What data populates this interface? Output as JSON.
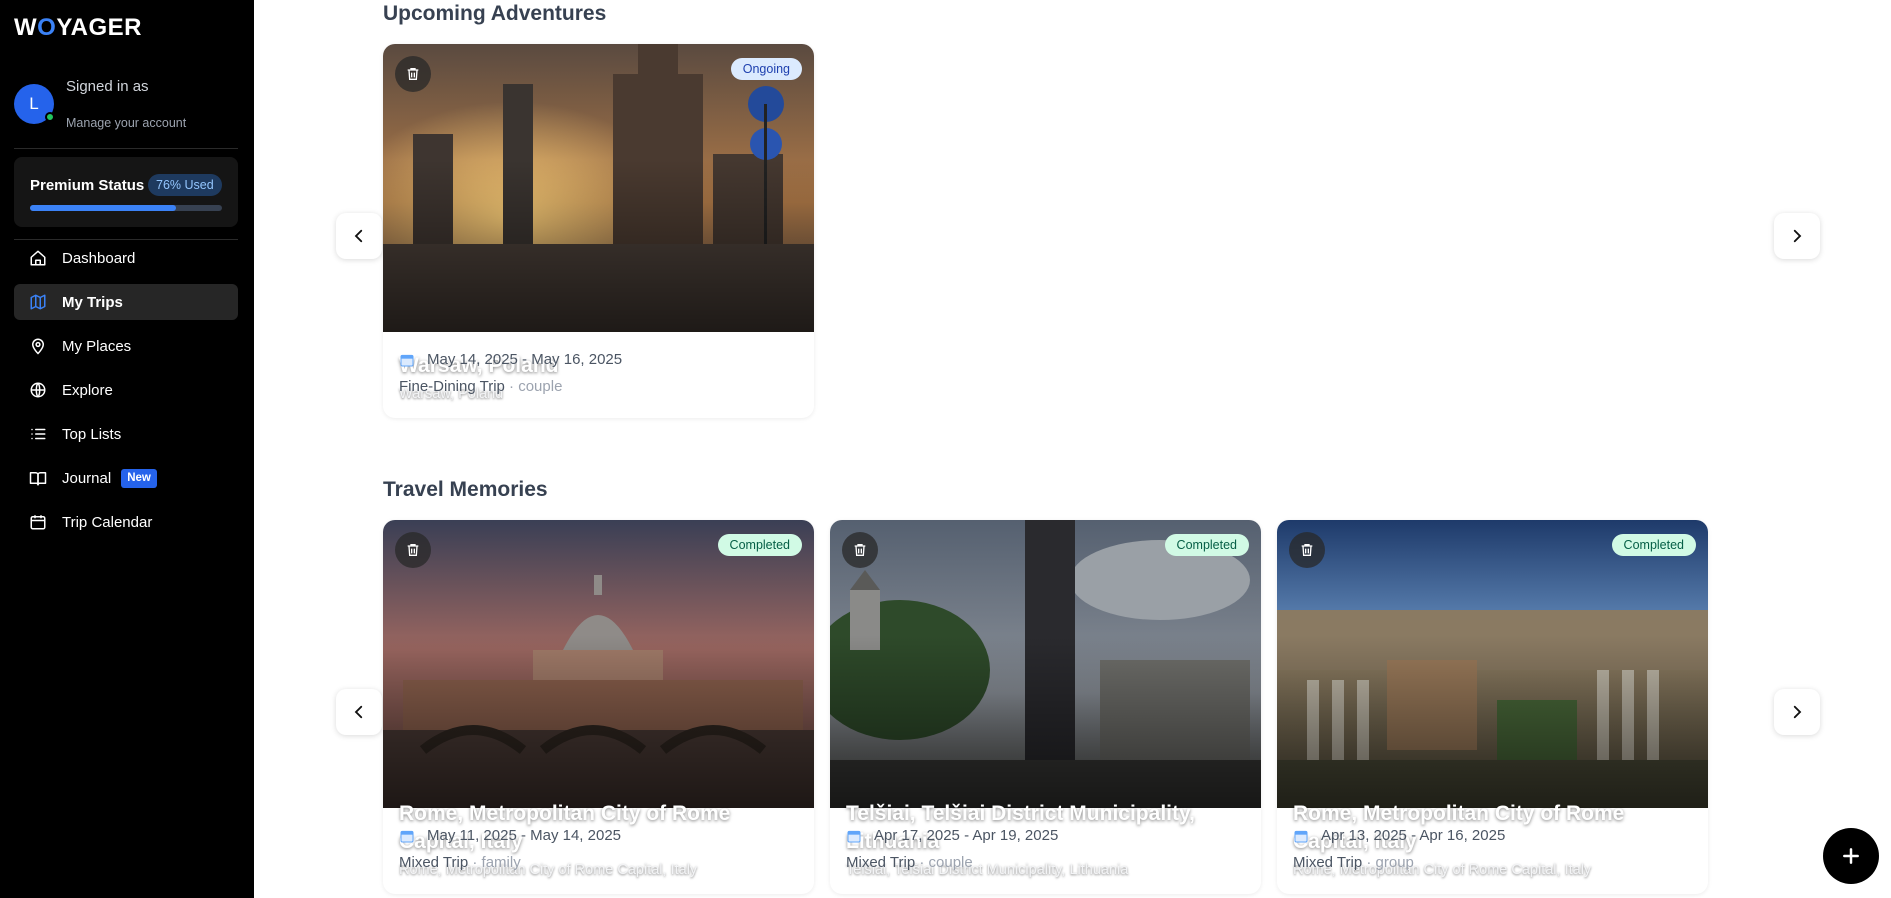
{
  "brand": {
    "logo_pre": "W",
    "logo_o": "O",
    "logo_post": "YAGER"
  },
  "user": {
    "initial": "L",
    "signed_in": "Signed in as",
    "manage": "Manage your account"
  },
  "premium": {
    "label": "Premium Status",
    "badge": "76% Used",
    "used_fraction": 0.76
  },
  "nav": [
    {
      "label": "Dashboard",
      "icon": "home-icon"
    },
    {
      "label": "My Trips",
      "icon": "map-icon",
      "active": true
    },
    {
      "label": "My Places",
      "icon": "map-pin-icon"
    },
    {
      "label": "Explore",
      "icon": "globe-icon"
    },
    {
      "label": "Top Lists",
      "icon": "list-icon"
    },
    {
      "label": "Journal",
      "icon": "book-icon",
      "badge": "New"
    },
    {
      "label": "Trip Calendar",
      "icon": "calendar-icon"
    }
  ],
  "sections": {
    "upcoming": {
      "title": "Upcoming Adventures",
      "cards": [
        {
          "status": "Ongoing",
          "title": "Warsaw, Poland",
          "subtitle": "Warsaw, Poland",
          "dates": "May 14, 2025 - May 16, 2025",
          "trip_type": "Fine-Dining Trip",
          "companions": "· couple"
        }
      ]
    },
    "memories": {
      "title": "Travel Memories",
      "cards": [
        {
          "status": "Completed",
          "title": "Rome, Metropolitan City of Rome Capital, Italy",
          "subtitle": "Rome, Metropolitan City of Rome Capital, Italy",
          "dates": "May 11, 2025 - May 14, 2025",
          "trip_type": "Mixed Trip",
          "companions": "· family"
        },
        {
          "status": "Completed",
          "title": "Telšiai, Telšiai District Municipality, Lithuania",
          "subtitle": "Telšiai, Telšiai District Municipality, Lithuania",
          "dates": "Apr 17, 2025 - Apr 19, 2025",
          "trip_type": "Mixed Trip",
          "companions": "· couple"
        },
        {
          "status": "Completed",
          "title": "Rome, Metropolitan City of Rome Capital, Italy",
          "subtitle": "Rome, Metropolitan City of Rome Capital, Italy",
          "dates": "Apr 13, 2025 - Apr 16, 2025",
          "trip_type": "Mixed Trip",
          "companions": "· group"
        }
      ]
    }
  },
  "colors": {
    "accent": "#3b82f6",
    "ongoing_bg": "#dbeafe",
    "completed_bg": "#d1fae5"
  }
}
